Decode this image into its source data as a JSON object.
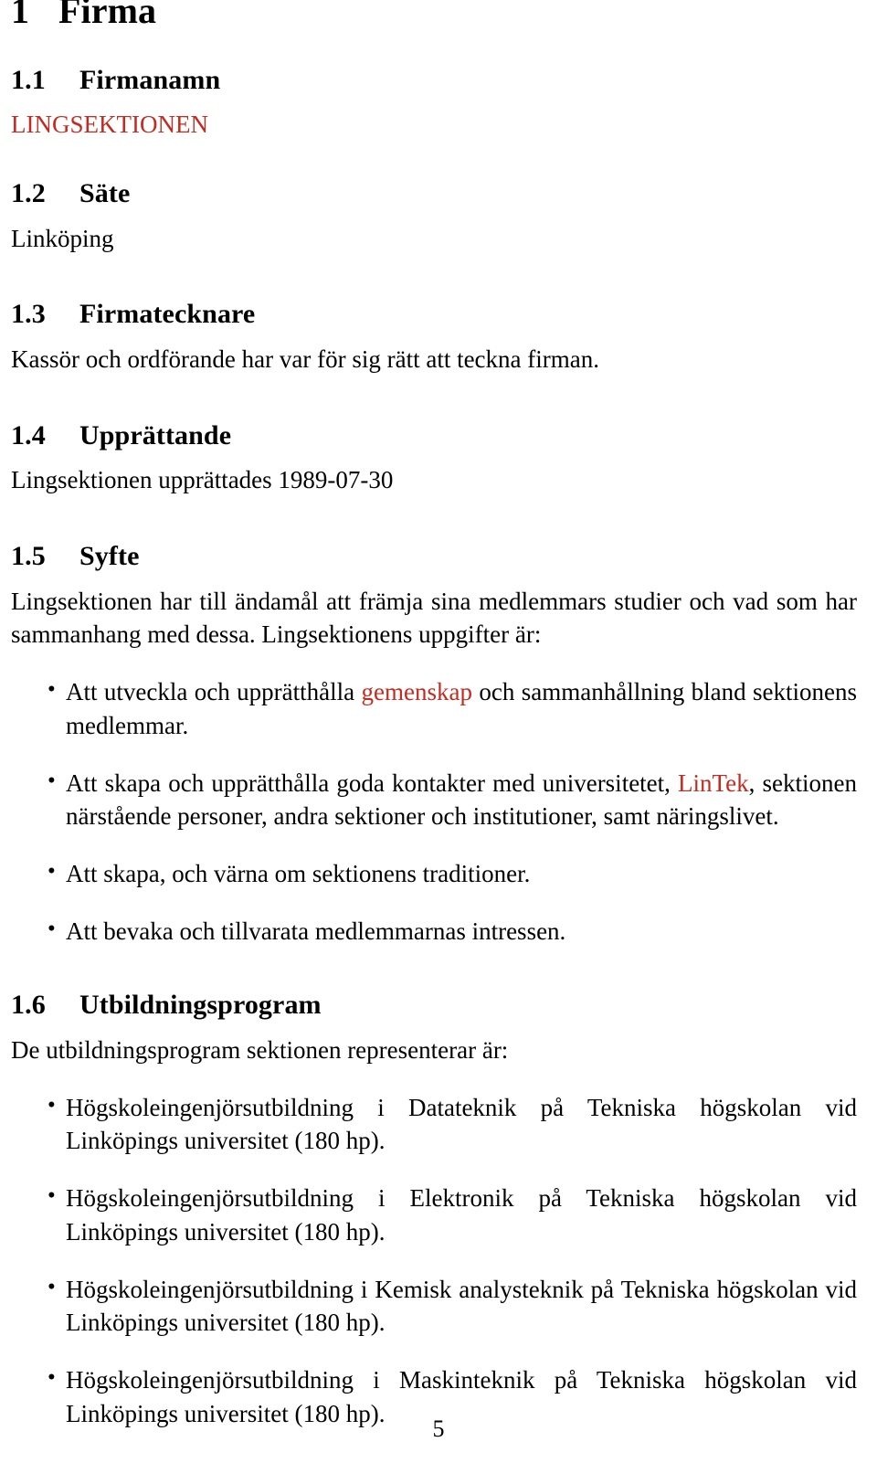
{
  "document": {
    "type": "statutes-page",
    "language": "sv",
    "link_color": "#C42B20",
    "text_color": "#000000",
    "background_color": "#FFFFFF"
  },
  "section": {
    "number": "1",
    "title": "Firma"
  },
  "subsections": [
    {
      "number": "1.1",
      "title": "Firmanamn",
      "body_link": "LINGSEKTIONEN"
    },
    {
      "number": "1.2",
      "title": "Säte",
      "body": "Linköping"
    },
    {
      "number": "1.3",
      "title": "Firmatecknare",
      "body": "Kassör och ordförande har var för sig rätt att teckna firman."
    },
    {
      "number": "1.4",
      "title": "Upprättande",
      "body": "Lingsektionen upprättades 1989-07-30"
    },
    {
      "number": "1.5",
      "title": "Syfte",
      "intro": "Lingsektionen har till ändamål att främja sina medlemmars studier och vad som har sammanhang med dessa. Lingsektionens uppgifter är:",
      "bullets": [
        {
          "pre": "Att utveckla och upprätthålla ",
          "link": "gemenskap",
          "post": " och sammanhållning bland sektionens medlemmar."
        },
        {
          "pre": "Att skapa och upprätthålla goda kontakter med universitetet, ",
          "link": "LinTek",
          "post": ", sektionen närstående personer, andra sektioner och institutioner, samt näringslivet."
        },
        {
          "pre": "Att skapa, och värna om sektionens traditioner.",
          "link": "",
          "post": ""
        },
        {
          "pre": "Att bevaka och tillvarata medlemmarnas intressen.",
          "link": "",
          "post": ""
        }
      ]
    },
    {
      "number": "1.6",
      "title": "Utbildningsprogram",
      "intro": "De utbildningsprogram sektionen representerar är:",
      "bullets": [
        {
          "text": "Högskoleingenjörsutbildning i Datateknik på Tekniska högskolan vid Linköpings universitet (180 hp)."
        },
        {
          "text": "Högskoleingenjörsutbildning i Elektronik på Tekniska högskolan vid Linköpings universitet (180 hp)."
        },
        {
          "text": "Högskoleingenjörsutbildning i Kemisk analysteknik på Tekniska högskolan vid Linköpings universitet (180 hp)."
        },
        {
          "text": "Högskoleingenjörsutbildning i Maskinteknik på Tekniska högskolan vid Linköpings universitet (180 hp)."
        }
      ]
    }
  ],
  "footer": {
    "page_number": "5"
  }
}
